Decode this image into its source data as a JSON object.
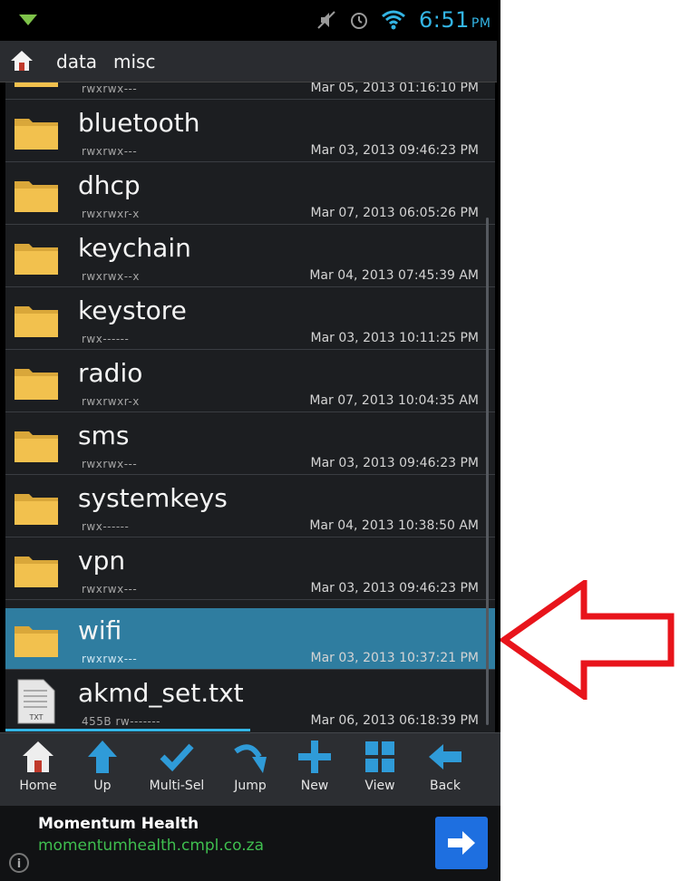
{
  "status_bar": {
    "time": "6:51",
    "ampm": "PM"
  },
  "breadcrumb": {
    "segments": [
      "data",
      "misc"
    ]
  },
  "files": [
    {
      "name": "",
      "perm": "rwxrwx---",
      "date": "Mar 05, 2013 01:16:10 PM",
      "type": "folder"
    },
    {
      "name": "bluetooth",
      "perm": "rwxrwx---",
      "date": "Mar 03, 2013 09:46:23 PM",
      "type": "folder"
    },
    {
      "name": "dhcp",
      "perm": "rwxrwxr-x",
      "date": "Mar 07, 2013 06:05:26 PM",
      "type": "folder"
    },
    {
      "name": "keychain",
      "perm": "rwxrwx--x",
      "date": "Mar 04, 2013 07:45:39 AM",
      "type": "folder"
    },
    {
      "name": "keystore",
      "perm": "rwx------",
      "date": "Mar 03, 2013 10:11:25 PM",
      "type": "folder"
    },
    {
      "name": "radio",
      "perm": "rwxrwxr-x",
      "date": "Mar 07, 2013 10:04:35 AM",
      "type": "folder"
    },
    {
      "name": "sms",
      "perm": "rwxrwx---",
      "date": "Mar 03, 2013 09:46:23 PM",
      "type": "folder"
    },
    {
      "name": "systemkeys",
      "perm": "rwx------",
      "date": "Mar 04, 2013 10:38:50 AM",
      "type": "folder"
    },
    {
      "name": "vpn",
      "perm": "rwxrwx---",
      "date": "Mar 03, 2013 09:46:23 PM",
      "type": "folder"
    },
    {
      "name": "wifi",
      "perm": "rwxrwx---",
      "date": "Mar 03, 2013 10:37:21 PM",
      "type": "folder",
      "selected": true
    },
    {
      "name": "akmd_set.txt",
      "perm": "455B rw-------",
      "date": "Mar 06, 2013 06:18:39 PM",
      "type": "file",
      "file_icon_label": "TXT"
    }
  ],
  "toolbar": {
    "home": "Home",
    "up": "Up",
    "multisel": "Multi-Sel",
    "jump": "Jump",
    "new": "New",
    "view": "View",
    "back": "Back"
  },
  "ad": {
    "title": "Momentum Health",
    "url": "momentumhealth.cmpl.co.za",
    "info_glyph": "i"
  },
  "colors": {
    "accent": "#33b5e5",
    "selected_row": "#2f7da0",
    "folder": "#f2c14e",
    "annotation_arrow": "#e8141b"
  },
  "annotation": {
    "type": "arrow-left-outline",
    "color": "#e8141b"
  }
}
